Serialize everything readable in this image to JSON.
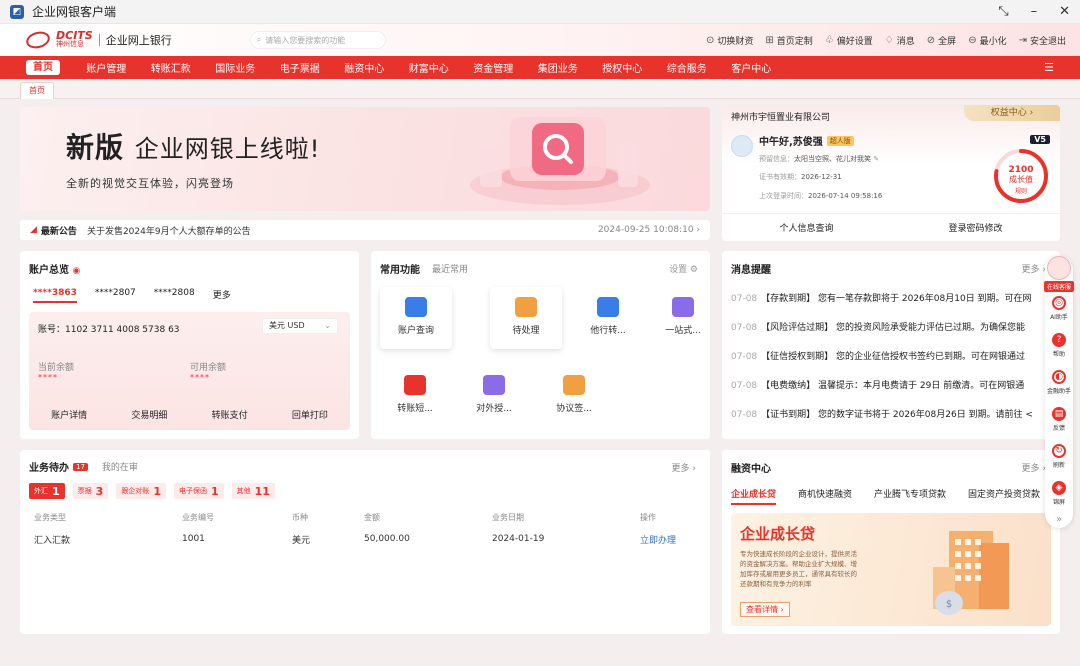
{
  "window": {
    "title": "企业网银客户端",
    "controls": [
      "⤡",
      "–",
      "✕"
    ]
  },
  "header": {
    "logo_en": "DCITS",
    "logo_cn": "神州信息",
    "bank_name": "企业网上银行",
    "search_placeholder": "请输入您要搜索的功能",
    "tools": [
      {
        "icon": "switch-icon",
        "glyph": "⊙",
        "label": "切换财资"
      },
      {
        "icon": "grid-icon",
        "glyph": "⊞",
        "label": "首页定制"
      },
      {
        "icon": "shirt-icon",
        "glyph": "♧",
        "label": "偏好设置"
      },
      {
        "icon": "bell-icon",
        "glyph": "♢",
        "label": "消息"
      },
      {
        "icon": "fullscreen-icon",
        "glyph": "⊘",
        "label": "全屏"
      },
      {
        "icon": "minimize-icon",
        "glyph": "⊖",
        "label": "最小化"
      },
      {
        "icon": "logout-icon",
        "glyph": "⇥",
        "label": "安全退出"
      }
    ]
  },
  "nav": {
    "items": [
      "首页",
      "账户管理",
      "转账汇款",
      "国际业务",
      "电子票据",
      "融资中心",
      "财富中心",
      "资金管理",
      "集团业务",
      "授权中心",
      "综合服务",
      "客户中心"
    ],
    "more_glyph": "☰"
  },
  "tabs": {
    "home": "首页"
  },
  "banner": {
    "title_bold": "新版",
    "title_light": "企业网银上线啦!",
    "subtitle": "全新的视觉交互体验，闪亮登场"
  },
  "notice": {
    "tag": "最新公告",
    "text": "关于发售2024年9月个人大额存单的公告",
    "time": "2024-09-25 10:08:10 ›"
  },
  "profile": {
    "company": "神州市宇恒置业有限公司",
    "rights": "权益中心 ›",
    "greeting": "中午好,苏俊强",
    "role_badge": "超人版",
    "pref_label": "预留信息：",
    "pref_value": "太阳当空照、花儿对我笑",
    "cert_label": "证书有效期：",
    "cert_value": "2026-12-31",
    "login_label": "上次登录时间：",
    "login_value": "2026-07-14 09:58:16",
    "level": "V5",
    "growth_value": "2100",
    "growth_label": "成长值",
    "growth_rule": "规则",
    "growth_ratio": 0.78,
    "actions": [
      "个人信息查询",
      "登录密码修改"
    ]
  },
  "accounts": {
    "title": "账户总览",
    "tabs": [
      "****3863",
      "****2807",
      "****2808",
      "更多"
    ],
    "account_no_label": "账号：",
    "account_no": "1102 3711 4008 5738 63",
    "currency": "美元 USD",
    "current_balance_label": "当前余额",
    "current_balance": "****",
    "available_balance_label": "可用余额",
    "available_balance": "****",
    "actions": [
      "账户详情",
      "交易明细",
      "转账支付",
      "回单打印"
    ]
  },
  "functions": {
    "tab_common": "常用功能",
    "tab_recent": "最近常用",
    "settings": "设置 ⚙",
    "items": [
      {
        "label": "账户查询",
        "color": "#3b7de8",
        "raised": true
      },
      {
        "label": "待处理",
        "color": "#f0a040",
        "raised": true
      },
      {
        "label": "他行转...",
        "color": "#3b7de8",
        "raised": false
      },
      {
        "label": "一站式...",
        "color": "#8a6be8",
        "raised": false
      },
      {
        "label": "转账短...",
        "color": "#e8322c",
        "raised": false
      },
      {
        "label": "对外授...",
        "color": "#8a6be8",
        "raised": false
      },
      {
        "label": "协议签...",
        "color": "#f0a040",
        "raised": false
      }
    ]
  },
  "messages": {
    "title": "消息提醒",
    "more": "更多 ›",
    "items": [
      {
        "date": "07-08",
        "text": "【存款到期】 您有一笔存款即将于 2026年08月10日 到期。可在网"
      },
      {
        "date": "07-08",
        "text": "【风险评估过期】 您的投资风险承受能力评估已过期。为确保您能"
      },
      {
        "date": "07-08",
        "text": "【征信授权到期】 您的企业征信授权书签约已到期。可在网银通过"
      },
      {
        "date": "07-08",
        "text": "【电费缴纳】 温馨提示：本月电费请于 29日 前缴清。可在网银通"
      },
      {
        "date": "07-08",
        "text": "【证书到期】 您的数字证书将于 2026年08月26日 到期。请前往 <"
      }
    ]
  },
  "todo": {
    "title": "业务待办",
    "count": "17",
    "mine": "我的在审",
    "more": "更多 ›",
    "chips": [
      {
        "label": "外汇",
        "count": "1",
        "active": true
      },
      {
        "label": "票据",
        "count": "3",
        "active": false
      },
      {
        "label": "跟企对账",
        "count": "1",
        "active": false
      },
      {
        "label": "电子保函",
        "count": "1",
        "active": false
      },
      {
        "label": "其他",
        "count": "11",
        "active": false
      }
    ],
    "columns": [
      "业务类型",
      "业务编号",
      "币种",
      "金额",
      "业务日期",
      "操作"
    ],
    "rows": [
      [
        "汇入汇款",
        "1001",
        "美元",
        "50,000.00",
        "2024-01-19",
        "立即办理"
      ]
    ]
  },
  "financing": {
    "title": "融资中心",
    "more": "更多 ›",
    "tabs": [
      "企业成长贷",
      "商机快速融资",
      "产业腾飞专项贷款",
      "固定资产投资贷款"
    ],
    "promo_title": "企业成长贷",
    "promo_desc": "专为快速成长阶段的企业设计，提供灵活的资金解决方案。帮助企业扩大规模、增加库存或雇用更多员工，通常具有较长的还款期和有竞争力的利率",
    "promo_btn": "查看详情 ›"
  },
  "floatbar": {
    "service": "在线客服",
    "items": [
      {
        "label": "AI助手",
        "glyph": "◎"
      },
      {
        "label": "帮助",
        "glyph": "?"
      },
      {
        "label": "金融助手",
        "glyph": "◐"
      },
      {
        "label": "反馈",
        "glyph": "▤"
      },
      {
        "label": "刷新",
        "glyph": "↻"
      },
      {
        "label": "锦屏",
        "glyph": "◈"
      }
    ],
    "collapse": "»"
  },
  "colors": {
    "brand": "#e8322c",
    "link": "#2d6fd1"
  }
}
